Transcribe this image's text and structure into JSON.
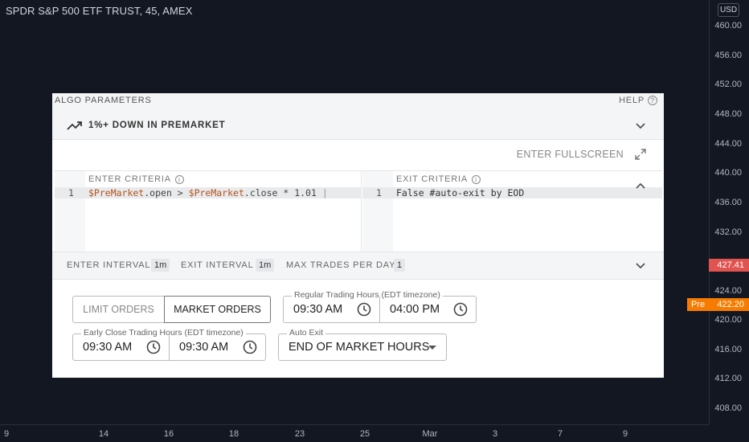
{
  "chart": {
    "title": "SPDR S&P 500 ETF TRUST, 45, AMEX",
    "currency": "USD",
    "y_ticks": [
      "460.00",
      "456.00",
      "452.00",
      "448.00",
      "444.00",
      "440.00",
      "436.00",
      "432.00",
      "424.00",
      "420.00",
      "416.00",
      "412.00",
      "408.00"
    ],
    "x_ticks": [
      "9",
      "14",
      "16",
      "18",
      "23",
      "25",
      "Mar",
      "3",
      "7",
      "9"
    ],
    "last_price": "427.41",
    "pre_label": "Pre",
    "pre_price": "422.20",
    "colors": {
      "background": "#131722",
      "down": "#e0534f",
      "premarket": "#f57c00"
    }
  },
  "panel": {
    "title": "ALGO PARAMETERS",
    "help_label": "HELP",
    "strategy_name": "1%+ DOWN IN PREMARKET",
    "fullscreen_label": "ENTER FULLSCREEN",
    "enter_criteria": {
      "label": "ENTER CRITERIA",
      "line_number": "1",
      "code": {
        "t1": "$PreMarket",
        "t2": ".open > ",
        "t3": "$PreMarket",
        "t4": ".close * 1.01"
      }
    },
    "exit_criteria": {
      "label": "EXIT CRITERIA",
      "line_number": "1",
      "code": "False #auto-exit by EOD"
    },
    "intervals": {
      "enter_label": "ENTER INTERVAL",
      "enter_value": "1m",
      "exit_label": "EXIT INTERVAL",
      "exit_value": "1m",
      "max_label": "MAX TRADES PER DAY",
      "max_value": "1"
    },
    "order_type": {
      "limit_label": "LIMIT ORDERS",
      "market_label": "MARKET ORDERS",
      "selected": "MARKET ORDERS"
    },
    "regular_hours": {
      "legend": "Regular Trading Hours (EDT timezone)",
      "start": "09:30 AM",
      "end": "04:00 PM"
    },
    "early_close": {
      "legend": "Early Close Trading Hours (EDT timezone)",
      "start": "09:30 AM",
      "end": "09:30 AM"
    },
    "auto_exit": {
      "legend": "Auto Exit",
      "value": "END OF MARKET HOURS"
    }
  }
}
